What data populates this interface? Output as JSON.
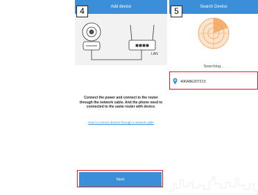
{
  "steps": {
    "step4": {
      "badge": "4",
      "title": "Add device",
      "instruction": "Connect the power and connect to the router through the network cable. And the phone need to connected to the same router with device.",
      "help_link": "How to connect devices through a network cable",
      "next_label": "Next",
      "illustration": {
        "router_port_label": "LAN"
      }
    },
    "step5": {
      "badge": "5",
      "title": "Search Device",
      "searching_text": "Searching...",
      "found_device_id": "406A8E207213"
    }
  },
  "colors": {
    "accent": "#3b8fd9",
    "highlight": "#e0182a",
    "radar": "#f2a35a"
  },
  "icons": [
    "camera-icon",
    "router-icon",
    "radar-icon",
    "location-pin-icon"
  ]
}
